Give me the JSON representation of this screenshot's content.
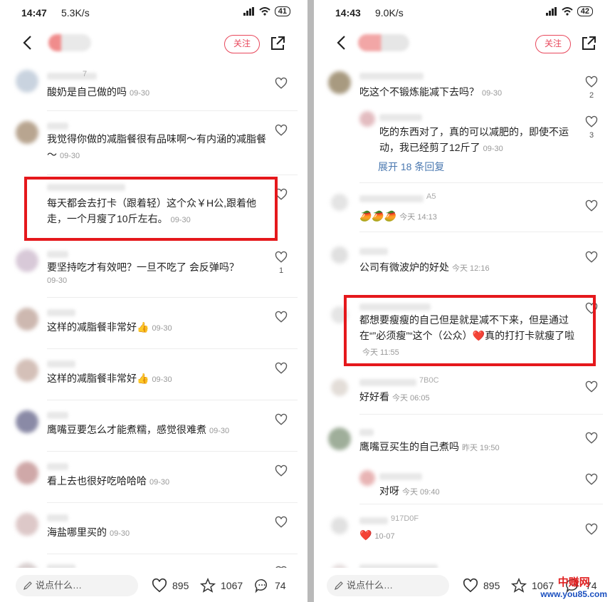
{
  "left": {
    "status": {
      "time": "14:47",
      "speed": "5.3K/s",
      "battery": "41"
    },
    "follow_label": "关注",
    "comments": [
      {
        "text": "酸奶是自己做的吗",
        "time": "09-30",
        "likes": "",
        "name_fragment": "7"
      },
      {
        "text": "我觉得你做的减脂餐很有品味啊～有内涵的减脂餐～",
        "time": "09-30",
        "likes": ""
      },
      {
        "text": "每天都会去打卡（跟着轻）这个众￥H公,跟着他走，一个月瘦了10斤左右。",
        "time": "09-30",
        "likes": ""
      },
      {
        "text": "要坚持吃才有效吧？一旦不吃了 会反弹吗？",
        "time": "09-30",
        "likes": "1"
      },
      {
        "text": "这样的减脂餐非常好👍",
        "time": "09-30",
        "likes": ""
      },
      {
        "text": "这样的减脂餐非常好👍",
        "time": "09-30",
        "likes": ""
      },
      {
        "text": "鹰嘴豆要怎么才能煮糯，感觉很难煮",
        "time": "09-30",
        "likes": ""
      },
      {
        "text": "看上去也很好吃哈哈哈",
        "time": "09-30",
        "likes": ""
      },
      {
        "text": "海盐哪里买的",
        "time": "09-30",
        "likes": ""
      }
    ],
    "bottom": {
      "placeholder": "说点什么…",
      "likes": "895",
      "stars": "1067",
      "comments": "74"
    }
  },
  "right": {
    "status": {
      "time": "14:43",
      "speed": "9.0K/s",
      "battery": "42"
    },
    "follow_label": "关注",
    "comments": [
      {
        "text": "吃这个不锻炼能减下去吗？",
        "time": "09-30",
        "likes": "2"
      },
      {
        "text": "吃的东西对了，真的可以减肥的，即使不运动，我已经剪了12斤了",
        "time": "09-30",
        "likes": "3"
      },
      {
        "text": "🥭🥭🥭",
        "time": "今天 14:13",
        "likes": "",
        "name_fragment": "A5"
      },
      {
        "text": "公司有微波炉的好处",
        "time": "今天 12:16",
        "likes": ""
      },
      {
        "text": "都想要瘦瘦的自己但是就是减不下来，但是通过在“”必须瘦”“这个（公众）❤️真的打打卡就瘦了啦",
        "time": "今天 11:55",
        "likes": ""
      },
      {
        "text": "好好看",
        "time": "今天 06:05",
        "likes": "",
        "name_fragment": "7B0C"
      },
      {
        "text": "鹰嘴豆买生的自己煮吗",
        "time": "昨天 19:50",
        "likes": ""
      },
      {
        "text": "对呀",
        "time": "今天 09:40",
        "likes": ""
      },
      {
        "text": "❤️",
        "time": "10-07",
        "likes": "",
        "name_fragment": "917D0F"
      }
    ],
    "expand_label": "展开 18 条回复",
    "bottom": {
      "placeholder": "说点什么…",
      "likes": "895",
      "stars": "1067",
      "comments": "74"
    }
  },
  "watermark": {
    "line1": "中赚网",
    "line2": "www.you85.com"
  },
  "colors": {
    "accent": "#e8485c",
    "highlight": "#e5181c",
    "link": "#4a78b0"
  }
}
